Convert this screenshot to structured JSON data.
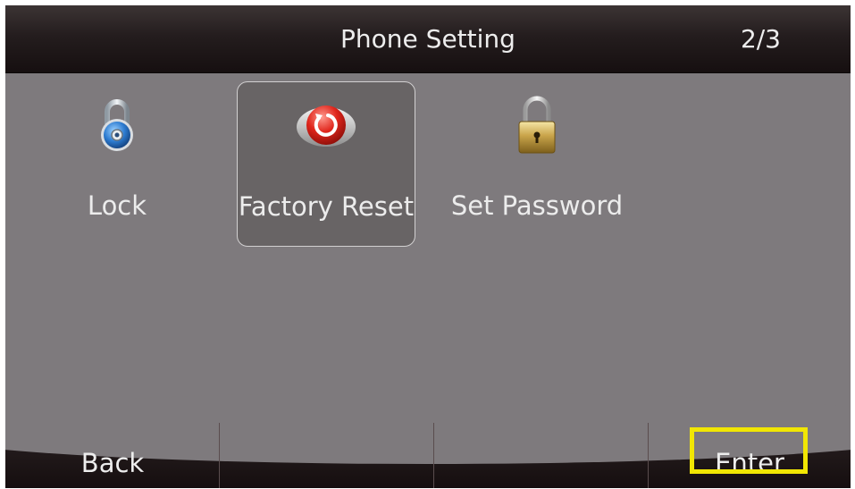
{
  "header": {
    "title": "Phone Setting",
    "page_indicator": "2/3"
  },
  "menu": {
    "items": [
      {
        "label": "Lock",
        "icon": "padlock-blue-icon",
        "selected": false
      },
      {
        "label": "Factory Reset",
        "icon": "reset-icon",
        "selected": true
      },
      {
        "label": "Set Password",
        "icon": "padlock-gold-icon",
        "selected": false
      }
    ]
  },
  "softkeys": {
    "back": "Back",
    "enter": "Enter"
  },
  "colors": {
    "highlight": "#f1e603",
    "screen_bg": "#7e7a7d"
  }
}
